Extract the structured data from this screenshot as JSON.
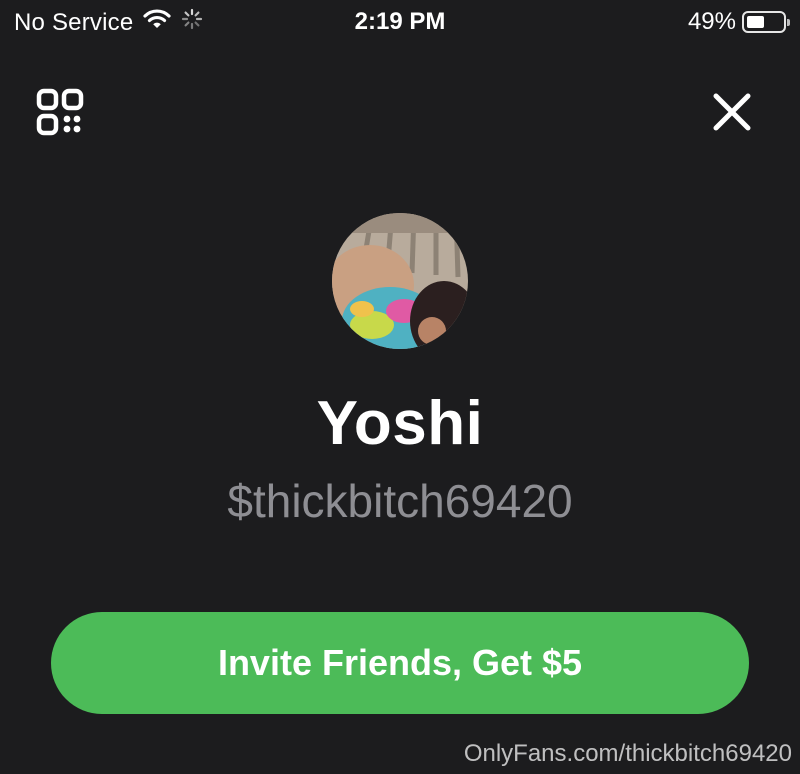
{
  "status_bar": {
    "carrier": "No Service",
    "time": "2:19 PM",
    "battery_percent": "49%",
    "battery_level": 0.49,
    "icons": [
      "wifi-icon",
      "activity-spinner-icon",
      "battery-icon"
    ]
  },
  "toolbar": {
    "left_icon": "qr-code-icon",
    "right_icon": "close-icon"
  },
  "profile": {
    "name": "Yoshi",
    "cashtag": "$thickbitch69420"
  },
  "invite_button": {
    "label": "Invite Friends, Get $5"
  },
  "watermark": "OnlyFans.com/thickbitch69420",
  "colors": {
    "background": "#1c1c1e",
    "accent_green": "#4cbb58",
    "secondary_text": "#8e8e93"
  }
}
